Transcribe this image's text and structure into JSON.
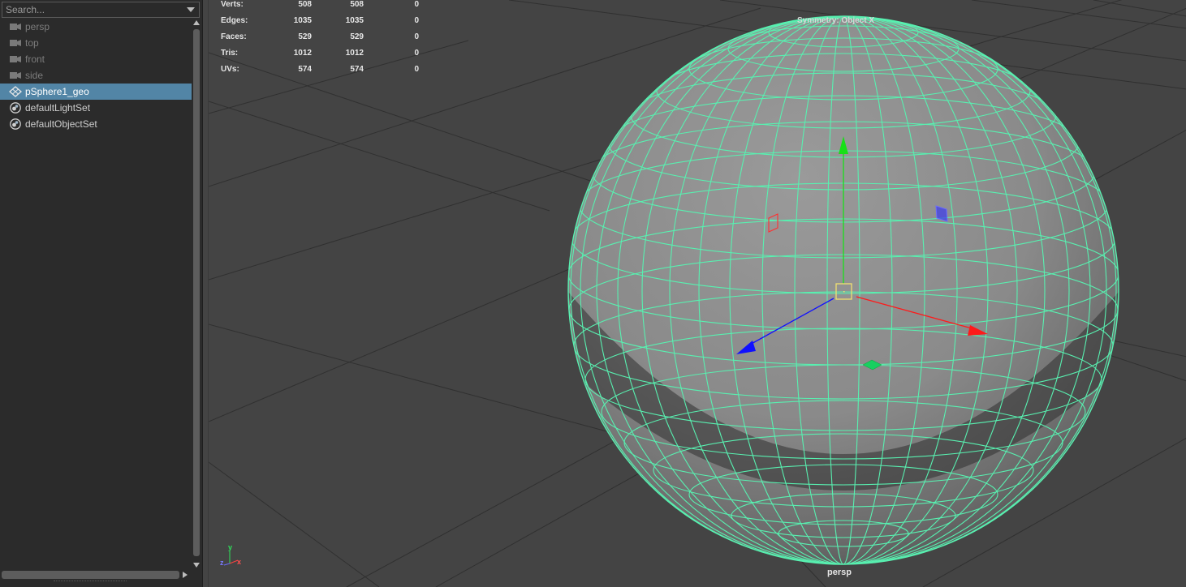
{
  "outliner": {
    "search_placeholder": "Search...",
    "items": [
      {
        "label": "persp",
        "icon": "camera-icon",
        "state": "hidden"
      },
      {
        "label": "top",
        "icon": "camera-icon",
        "state": "hidden"
      },
      {
        "label": "front",
        "icon": "camera-icon",
        "state": "hidden"
      },
      {
        "label": "side",
        "icon": "camera-icon",
        "state": "hidden"
      },
      {
        "label": "pSphere1_geo",
        "icon": "mesh-transform-icon",
        "state": "selected"
      },
      {
        "label": "defaultLightSet",
        "icon": "object-set-icon",
        "state": "normal"
      },
      {
        "label": "defaultObjectSet",
        "icon": "object-set-icon",
        "state": "normal"
      }
    ]
  },
  "viewport": {
    "poly_count": {
      "rows": [
        {
          "label": "Verts:",
          "v1": "508",
          "v2": "508",
          "v3": "0"
        },
        {
          "label": "Edges:",
          "v1": "1035",
          "v2": "1035",
          "v3": "0"
        },
        {
          "label": "Faces:",
          "v1": "529",
          "v2": "529",
          "v3": "0"
        },
        {
          "label": "Tris:",
          "v1": "1012",
          "v2": "1012",
          "v3": "0"
        },
        {
          "label": "UVs:",
          "v1": "574",
          "v2": "574",
          "v3": "0"
        }
      ]
    },
    "symmetry_label": "Symmetry: Object X",
    "camera_label": "persp",
    "axis_labels": {
      "x": "x",
      "y": "y",
      "z": "z"
    },
    "colors": {
      "background": "#444444",
      "grid_line": "#2f2f2f",
      "wireframe": "#58f0b0",
      "selection_highlight": "#5285a6",
      "axis_x": "#ff1a1a",
      "axis_y": "#18e018",
      "axis_z": "#1010ff",
      "pivot": "#f0e070"
    }
  }
}
